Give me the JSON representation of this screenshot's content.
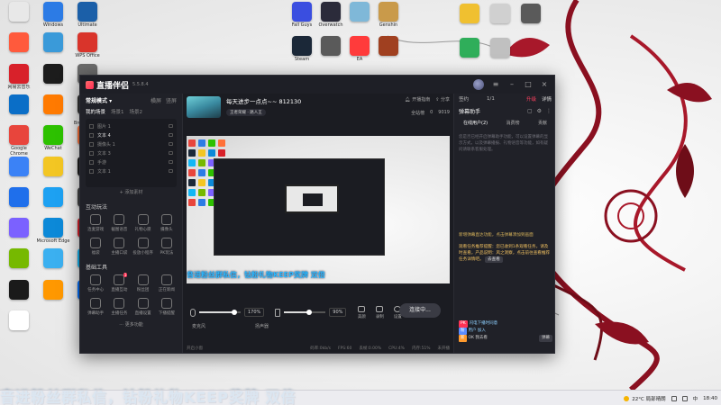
{
  "desktop": {
    "left_icons": [
      {
        "label": "",
        "color": "#e8e8e8"
      },
      {
        "label": "Windows",
        "color": "#2c7be5"
      },
      {
        "label": "Ultimate",
        "color": "#1b5fa8"
      },
      {
        "label": "",
        "color": "#ff5a3c"
      },
      {
        "label": "",
        "color": "#3a9ad9"
      },
      {
        "label": "WPS Office",
        "color": "#d9342b"
      },
      {
        "label": "网易云音乐",
        "color": "#d8212a"
      },
      {
        "label": "",
        "color": "#1c1c1c"
      },
      {
        "label": "",
        "color": "#6b6b6b"
      },
      {
        "label": "",
        "color": "#0a6ec7"
      },
      {
        "label": "",
        "color": "#ff7a00"
      },
      {
        "label": "Open Broadcaster",
        "color": "#333333"
      },
      {
        "label": "Google Chrome",
        "color": "#e8453c"
      },
      {
        "label": "WeChat",
        "color": "#2dc100"
      },
      {
        "label": "Firefox",
        "color": "#ff7139"
      },
      {
        "label": "",
        "color": "#3b82f6"
      },
      {
        "label": "",
        "color": "#f3c623"
      },
      {
        "label": "",
        "color": "#1e1e1e"
      },
      {
        "label": "",
        "color": "#1f6feb"
      },
      {
        "label": "",
        "color": "#1da1f2"
      },
      {
        "label": "",
        "color": "#444444"
      },
      {
        "label": "",
        "color": "#7b61ff"
      },
      {
        "label": "Microsoft Edge",
        "color": "#0c89d8"
      },
      {
        "label": "",
        "color": "#d8212a"
      },
      {
        "label": "",
        "color": "#76b900"
      },
      {
        "label": "",
        "color": "#3bb0f0"
      },
      {
        "label": "QQ",
        "color": "#12b7f5"
      },
      {
        "label": "",
        "color": "#1a1a1a"
      },
      {
        "label": "",
        "color": "#ff9800"
      },
      {
        "label": "Uplay",
        "color": "#0070ff"
      },
      {
        "label": "",
        "color": "#ffffff"
      }
    ],
    "top_icons": [
      {
        "label": "Fall Guys",
        "color": "#3a4ee0"
      },
      {
        "label": "Overwatch",
        "color": "#2b2b3a"
      },
      {
        "label": "",
        "color": "#7fb8d8"
      },
      {
        "label": "Genshin",
        "color": "#c99a4a"
      },
      {
        "label": "Steam",
        "color": "#1b2838"
      },
      {
        "label": "",
        "color": "#5a5a5a"
      },
      {
        "label": "EA",
        "color": "#ff3b3b"
      },
      {
        "label": "",
        "color": "#a04020"
      }
    ],
    "right_icons": [
      {
        "label": "",
        "color": "#f0c030"
      },
      {
        "label": "",
        "color": "#d0d0d0"
      },
      {
        "label": "",
        "color": "#5a5a5a"
      },
      {
        "label": "",
        "color": "#2fae5a"
      },
      {
        "label": "",
        "color": "#c0c0c0"
      }
    ]
  },
  "app": {
    "name": "直播伴侣",
    "version": "5.5.8.4",
    "left": {
      "mode": "常规模式",
      "mode_arrow": "▾",
      "actions": [
        "横屏",
        "竖屏"
      ],
      "scene_tabs": [
        "我的场景",
        "场景1",
        "场景2"
      ],
      "sources": [
        "图片 1",
        "文本 4",
        "摄像头 1",
        "文本 3",
        "手游",
        "文本 1"
      ],
      "add_source": "+ 添加素材",
      "section_interaction": "互动玩法",
      "interaction_tools": [
        "连麦游戏",
        "截图语音",
        "礼物心愿",
        "摄像头",
        "福袋",
        "主播口袋",
        "投放小程序",
        "PK玩法"
      ],
      "section_basic": "基础工具",
      "basic_tools": [
        {
          "label": "任务中心",
          "badge": ""
        },
        {
          "label": "直播互动",
          "badge": "1"
        },
        {
          "label": "粉丝团",
          "badge": ""
        },
        {
          "label": "正在新闻",
          "badge": ""
        },
        {
          "label": "弹幕助手",
          "badge": ""
        },
        {
          "label": "主播任务",
          "badge": ""
        },
        {
          "label": "直播设置",
          "badge": ""
        },
        {
          "label": "下播提醒",
          "badge": ""
        }
      ],
      "more": "更多功能"
    },
    "center": {
      "live_title": "每天进步一点点~~ 812130",
      "live_tag": "王者荣耀 · 路人王",
      "top_actions": [
        "开播指南",
        "分享"
      ],
      "small_actions": [
        "全站榜",
        "0",
        "9019"
      ],
      "preview_caption": "音进粉丝群私信，钻粉礼物KEEP奖牌 双倍",
      "mixer": {
        "mic_label": "麦克风",
        "mic_value": "170%",
        "mic_level": 0.85,
        "speaker_label": "扬声器",
        "speaker_value": "90%",
        "speaker_level": 0.6
      },
      "controls": [
        "美颜",
        "录制",
        "设置"
      ],
      "go_live": "连接中...",
      "status": [
        "开启小窗",
        "码率:0kb/s",
        "FPS:60",
        "丢帧:0.00%",
        "CPU:4%",
        "内存:51%",
        "未开播"
      ]
    },
    "right": {
      "top_label": "签约",
      "count": "1/1",
      "upgrade": "升级",
      "detail": "详情",
      "panel_title": "弹幕助手",
      "tabs": [
        "在线用户(2)",
        "消费榜",
        "贡献"
      ],
      "gray_text": "您是否已经开启弹幕助手功能，可以设置弹幕的显示方式，以及弹幕播报、礼物语音等功能，如有疑问请联系客服处理。",
      "notice_1": "新增弹幕直达功能，点击弹幕添加到画面",
      "notice_2": "观看任务推荐提醒：您已收到1条观看任务，请及时查看，产品说明：风之洞察，点击前往查看推荐任务详情吧。",
      "notice_btn": "去查看",
      "count_label": "0名观众",
      "chat": [
        {
          "tag": "PK",
          "text": "闪电下播时同意"
        },
        {
          "tag": "粉",
          "text": "用户 加入"
        },
        {
          "tag": "新",
          "text": "OK 我去看"
        }
      ],
      "mini_btn": "弹幕"
    }
  },
  "marquee": "音进粉丝群私信，钻粉礼物KEEP奖牌   双倍",
  "taskbar": {
    "weather": "22°C 局部晴朗",
    "time": "18:40"
  }
}
